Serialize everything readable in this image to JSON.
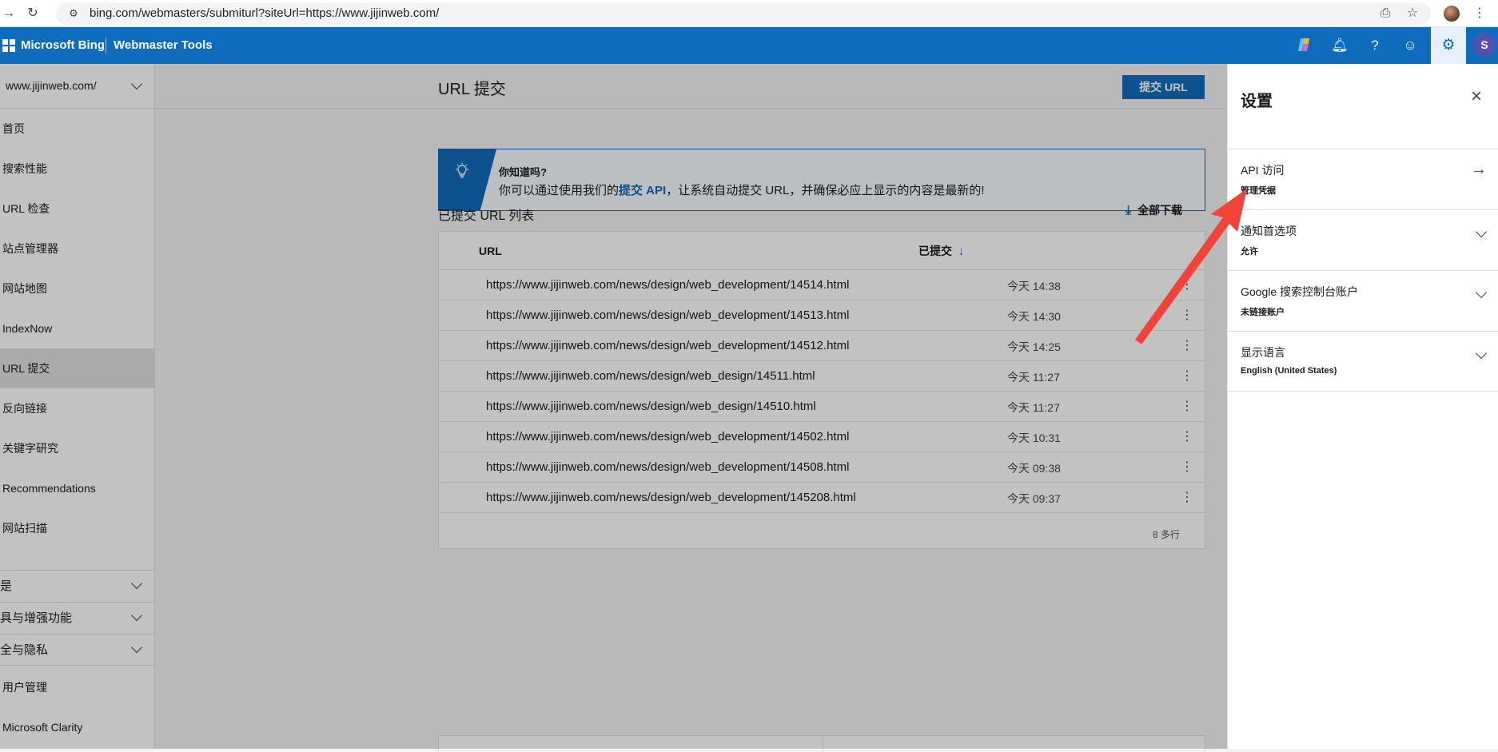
{
  "browser": {
    "url": "bing.com/webmasters/submiturl?siteUrl=https://www.jijinweb.com/"
  },
  "header": {
    "brand": "Microsoft Bing",
    "product": "Webmaster Tools",
    "user_initial": "S",
    "accent_color": "#0f6cbd"
  },
  "sidebar": {
    "site": "www.jijinweb.com/",
    "items": [
      {
        "label": "首页"
      },
      {
        "label": "搜索性能"
      },
      {
        "label": "URL 检查"
      },
      {
        "label": "站点管理器"
      },
      {
        "label": "网站地图"
      },
      {
        "label": "IndexNow"
      },
      {
        "label": "URL 提交"
      },
      {
        "label": "反向链接"
      },
      {
        "label": "关键字研究"
      },
      {
        "label": "Recommendations"
      },
      {
        "label": "网站扫描"
      }
    ],
    "groups": [
      {
        "label": "是"
      },
      {
        "label": "具与增强功能"
      },
      {
        "label": "全与隐私"
      }
    ],
    "bottom_items": [
      {
        "label": "用户管理"
      },
      {
        "label": "Microsoft Clarity"
      }
    ]
  },
  "main": {
    "title": "URL 提交",
    "submit_button": "提交 URL",
    "tip": {
      "title": "你知道吗?",
      "body_pre": "你可以通过使用我们的",
      "body_link": "提交 API",
      "body_post": "，让系统自动提交 URL，并确保必应上显示的内容是最新的!"
    },
    "list_title": "已提交 URL 列表",
    "download_label": "全部下载",
    "table": {
      "columns": [
        "URL",
        "已提交"
      ],
      "rows": [
        {
          "url": "https://www.jijinweb.com/news/design/web_development/14514.html",
          "time": "今天 14:38"
        },
        {
          "url": "https://www.jijinweb.com/news/design/web_development/14513.html",
          "time": "今天 14:30"
        },
        {
          "url": "https://www.jijinweb.com/news/design/web_development/14512.html",
          "time": "今天 14:25"
        },
        {
          "url": "https://www.jijinweb.com/news/design/web_design/14511.html",
          "time": "今天 11:27"
        },
        {
          "url": "https://www.jijinweb.com/news/design/web_design/14510.html",
          "time": "今天 11:27"
        },
        {
          "url": "https://www.jijinweb.com/news/design/web_development/14502.html",
          "time": "今天 10:31"
        },
        {
          "url": "https://www.jijinweb.com/news/design/web_development/14508.html",
          "time": "今天 09:38"
        },
        {
          "url": "https://www.jijinweb.com/news/design/web_development/145208.html",
          "time": "今天 09:37"
        }
      ],
      "row_count": "8 多行"
    }
  },
  "settings_panel": {
    "title": "设置",
    "items": [
      {
        "label": "API 访问",
        "sub": "管理凭据"
      },
      {
        "label": "通知首选项",
        "sub": "允许"
      },
      {
        "label": "Google 搜索控制台账户",
        "sub": "未链接账户"
      },
      {
        "label": "显示语言",
        "sub": "English (United States)"
      }
    ]
  },
  "annotation_color": "#f2423a"
}
